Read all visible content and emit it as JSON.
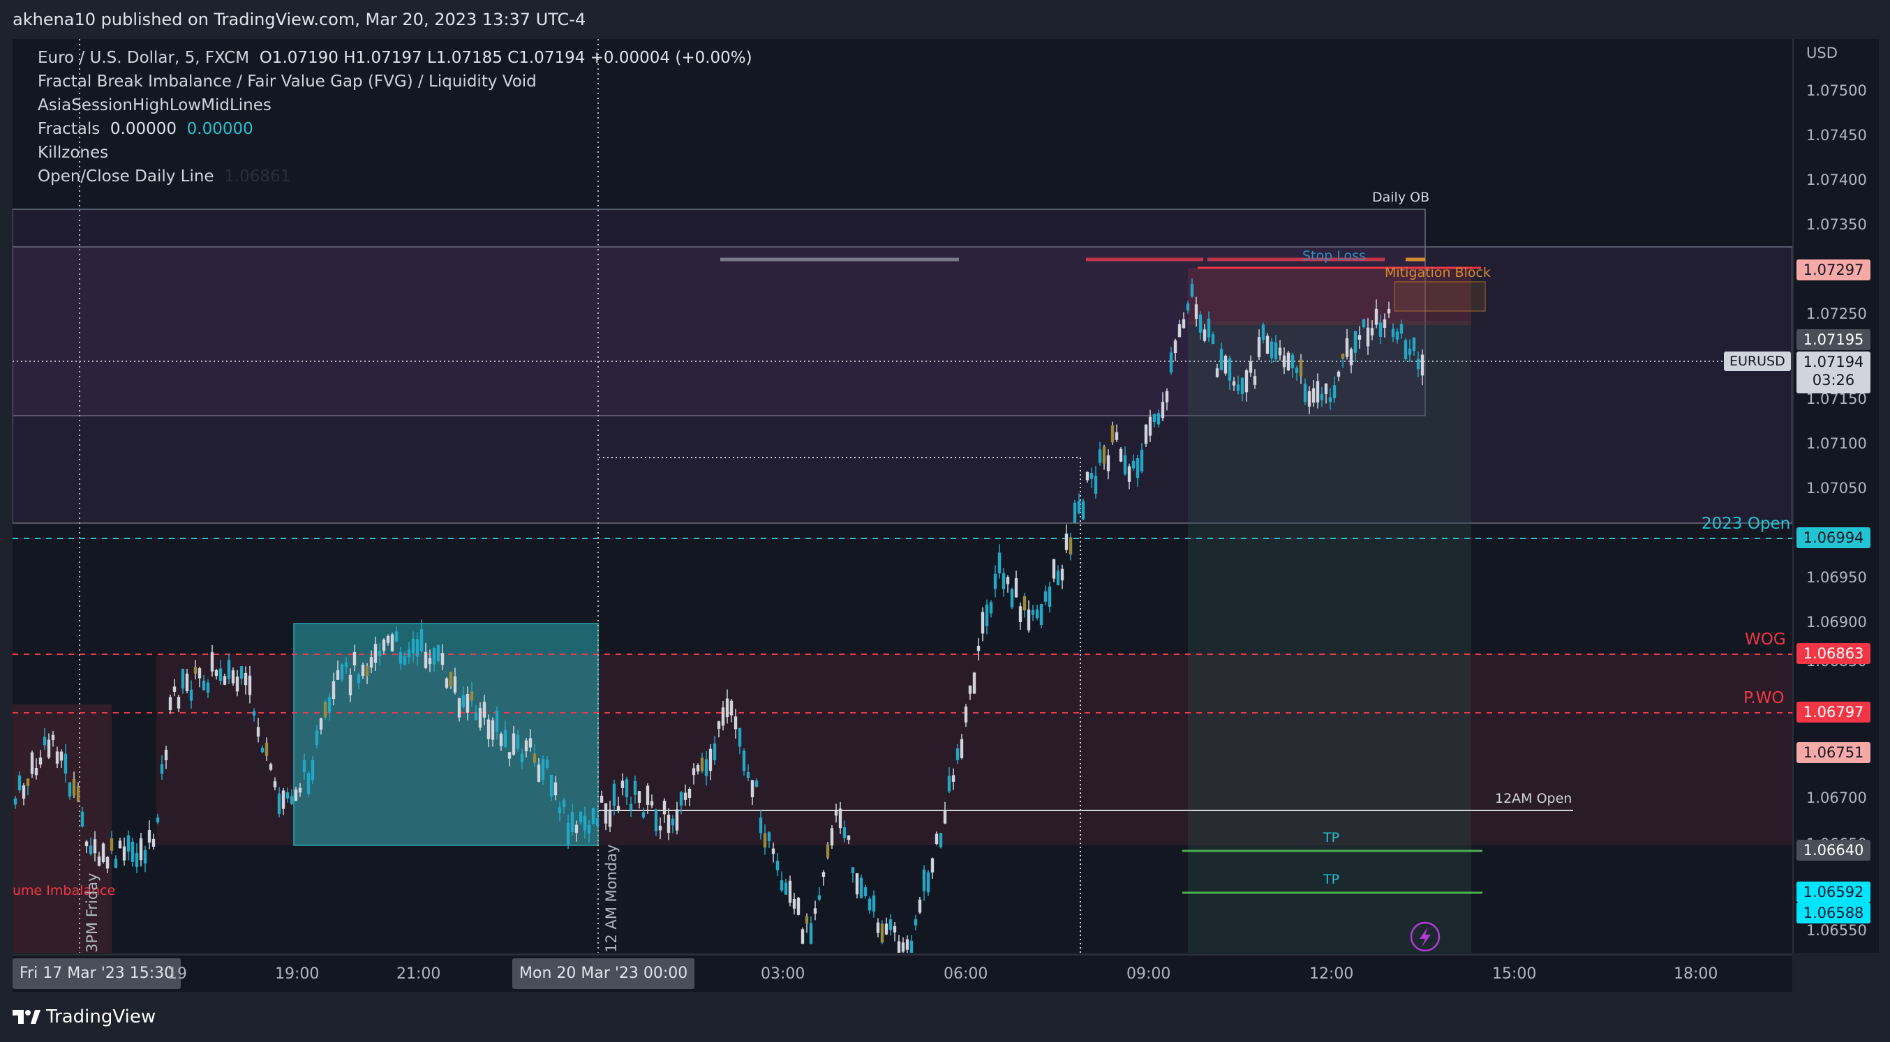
{
  "header": {
    "published_by": "akhena10 published on TradingView.com, Mar 20, 2023 13:37 UTC-4"
  },
  "legend": {
    "symbol": "Euro / U.S. Dollar, 5, FXCM",
    "ohlc": "O1.07190  H1.07197  L1.07185  C1.07194  +0.00004 (+0.00%)",
    "ind1": "Fractal Break Imbalance / Fair Value Gap (FVG) / Liquidity Void",
    "ind2": "AsiaSessionHighLowMidLines",
    "ind3_label": "Fractals",
    "ind3_v1": "0.00000",
    "ind3_v2": "0.00000",
    "ind4": "Killzones",
    "ind5_label": "Open/Close Daily Line",
    "ind5_value": "1.06861"
  },
  "annotations": {
    "daily_ob": "Daily OB",
    "stop_loss": "Stop Loss",
    "mitigation_block": "Mitigation Block",
    "open_2023": "2023 Open",
    "wog": "WOG",
    "pwo": "P.WO",
    "open_12am": "12AM Open",
    "tp1": "TP",
    "tp2": "TP",
    "symbol_tag": "EURUSD",
    "volume_imbalance": "ume Imbalance",
    "friday_3pm": "3PM Friday",
    "monday_12am": "12 AM Monday"
  },
  "price_axis": {
    "currency": "USD",
    "ticks": [
      "1.07500",
      "1.07450",
      "1.07400",
      "1.07350",
      "1.07250",
      "1.07150",
      "1.07100",
      "1.07050",
      "1.06950",
      "1.06900",
      "1.06850",
      "1.06700",
      "1.06650",
      "1.06550"
    ],
    "labels": {
      "p1": "1.07297",
      "p2": "1.07195",
      "p3": "1.07194",
      "countdown": "03:26",
      "p4": "1.06994",
      "p5": "1.06863",
      "p6": "1.06797",
      "p7": "1.06751",
      "p8": "1.06640",
      "p9": "1.06592",
      "p10": "1.06588"
    }
  },
  "time_axis": {
    "left_box": "Fri 17 Mar '23   15:30",
    "mid_box": "Mon 20 Mar '23   00:00",
    "ticks": [
      "19",
      "19:00",
      "21:00",
      "03:00",
      "06:00",
      "09:00",
      "12:00",
      "15:00",
      "18:00"
    ]
  },
  "footer": {
    "brand": "TradingView"
  },
  "colors": {
    "up": "#22a7c4",
    "down": "#d1d4dc",
    "purple_zone": "#8f4fa3",
    "red_zone": "#6b2d39",
    "cyan_zone": "#2aa6b0",
    "level_cyan": "#22c3d3",
    "level_red": "#f23645",
    "tp_green": "#4caf50"
  }
}
